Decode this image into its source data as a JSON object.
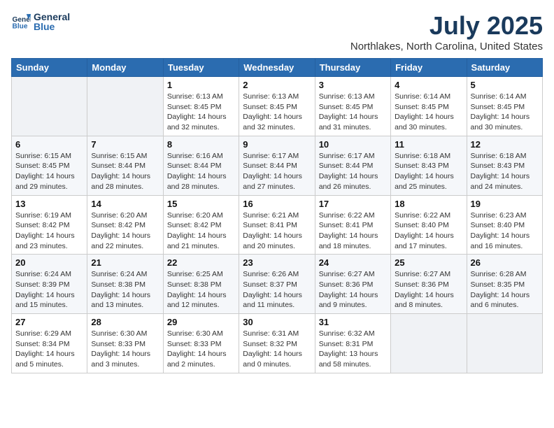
{
  "logo": {
    "line1": "General",
    "line2": "Blue"
  },
  "title": "July 2025",
  "location": "Northlakes, North Carolina, United States",
  "days_of_week": [
    "Sunday",
    "Monday",
    "Tuesday",
    "Wednesday",
    "Thursday",
    "Friday",
    "Saturday"
  ],
  "weeks": [
    [
      {
        "day": "",
        "info": ""
      },
      {
        "day": "",
        "info": ""
      },
      {
        "day": "1",
        "info": "Sunrise: 6:13 AM\nSunset: 8:45 PM\nDaylight: 14 hours and 32 minutes."
      },
      {
        "day": "2",
        "info": "Sunrise: 6:13 AM\nSunset: 8:45 PM\nDaylight: 14 hours and 32 minutes."
      },
      {
        "day": "3",
        "info": "Sunrise: 6:13 AM\nSunset: 8:45 PM\nDaylight: 14 hours and 31 minutes."
      },
      {
        "day": "4",
        "info": "Sunrise: 6:14 AM\nSunset: 8:45 PM\nDaylight: 14 hours and 30 minutes."
      },
      {
        "day": "5",
        "info": "Sunrise: 6:14 AM\nSunset: 8:45 PM\nDaylight: 14 hours and 30 minutes."
      }
    ],
    [
      {
        "day": "6",
        "info": "Sunrise: 6:15 AM\nSunset: 8:45 PM\nDaylight: 14 hours and 29 minutes."
      },
      {
        "day": "7",
        "info": "Sunrise: 6:15 AM\nSunset: 8:44 PM\nDaylight: 14 hours and 28 minutes."
      },
      {
        "day": "8",
        "info": "Sunrise: 6:16 AM\nSunset: 8:44 PM\nDaylight: 14 hours and 28 minutes."
      },
      {
        "day": "9",
        "info": "Sunrise: 6:17 AM\nSunset: 8:44 PM\nDaylight: 14 hours and 27 minutes."
      },
      {
        "day": "10",
        "info": "Sunrise: 6:17 AM\nSunset: 8:44 PM\nDaylight: 14 hours and 26 minutes."
      },
      {
        "day": "11",
        "info": "Sunrise: 6:18 AM\nSunset: 8:43 PM\nDaylight: 14 hours and 25 minutes."
      },
      {
        "day": "12",
        "info": "Sunrise: 6:18 AM\nSunset: 8:43 PM\nDaylight: 14 hours and 24 minutes."
      }
    ],
    [
      {
        "day": "13",
        "info": "Sunrise: 6:19 AM\nSunset: 8:42 PM\nDaylight: 14 hours and 23 minutes."
      },
      {
        "day": "14",
        "info": "Sunrise: 6:20 AM\nSunset: 8:42 PM\nDaylight: 14 hours and 22 minutes."
      },
      {
        "day": "15",
        "info": "Sunrise: 6:20 AM\nSunset: 8:42 PM\nDaylight: 14 hours and 21 minutes."
      },
      {
        "day": "16",
        "info": "Sunrise: 6:21 AM\nSunset: 8:41 PM\nDaylight: 14 hours and 20 minutes."
      },
      {
        "day": "17",
        "info": "Sunrise: 6:22 AM\nSunset: 8:41 PM\nDaylight: 14 hours and 18 minutes."
      },
      {
        "day": "18",
        "info": "Sunrise: 6:22 AM\nSunset: 8:40 PM\nDaylight: 14 hours and 17 minutes."
      },
      {
        "day": "19",
        "info": "Sunrise: 6:23 AM\nSunset: 8:40 PM\nDaylight: 14 hours and 16 minutes."
      }
    ],
    [
      {
        "day": "20",
        "info": "Sunrise: 6:24 AM\nSunset: 8:39 PM\nDaylight: 14 hours and 15 minutes."
      },
      {
        "day": "21",
        "info": "Sunrise: 6:24 AM\nSunset: 8:38 PM\nDaylight: 14 hours and 13 minutes."
      },
      {
        "day": "22",
        "info": "Sunrise: 6:25 AM\nSunset: 8:38 PM\nDaylight: 14 hours and 12 minutes."
      },
      {
        "day": "23",
        "info": "Sunrise: 6:26 AM\nSunset: 8:37 PM\nDaylight: 14 hours and 11 minutes."
      },
      {
        "day": "24",
        "info": "Sunrise: 6:27 AM\nSunset: 8:36 PM\nDaylight: 14 hours and 9 minutes."
      },
      {
        "day": "25",
        "info": "Sunrise: 6:27 AM\nSunset: 8:36 PM\nDaylight: 14 hours and 8 minutes."
      },
      {
        "day": "26",
        "info": "Sunrise: 6:28 AM\nSunset: 8:35 PM\nDaylight: 14 hours and 6 minutes."
      }
    ],
    [
      {
        "day": "27",
        "info": "Sunrise: 6:29 AM\nSunset: 8:34 PM\nDaylight: 14 hours and 5 minutes."
      },
      {
        "day": "28",
        "info": "Sunrise: 6:30 AM\nSunset: 8:33 PM\nDaylight: 14 hours and 3 minutes."
      },
      {
        "day": "29",
        "info": "Sunrise: 6:30 AM\nSunset: 8:33 PM\nDaylight: 14 hours and 2 minutes."
      },
      {
        "day": "30",
        "info": "Sunrise: 6:31 AM\nSunset: 8:32 PM\nDaylight: 14 hours and 0 minutes."
      },
      {
        "day": "31",
        "info": "Sunrise: 6:32 AM\nSunset: 8:31 PM\nDaylight: 13 hours and 58 minutes."
      },
      {
        "day": "",
        "info": ""
      },
      {
        "day": "",
        "info": ""
      }
    ]
  ]
}
